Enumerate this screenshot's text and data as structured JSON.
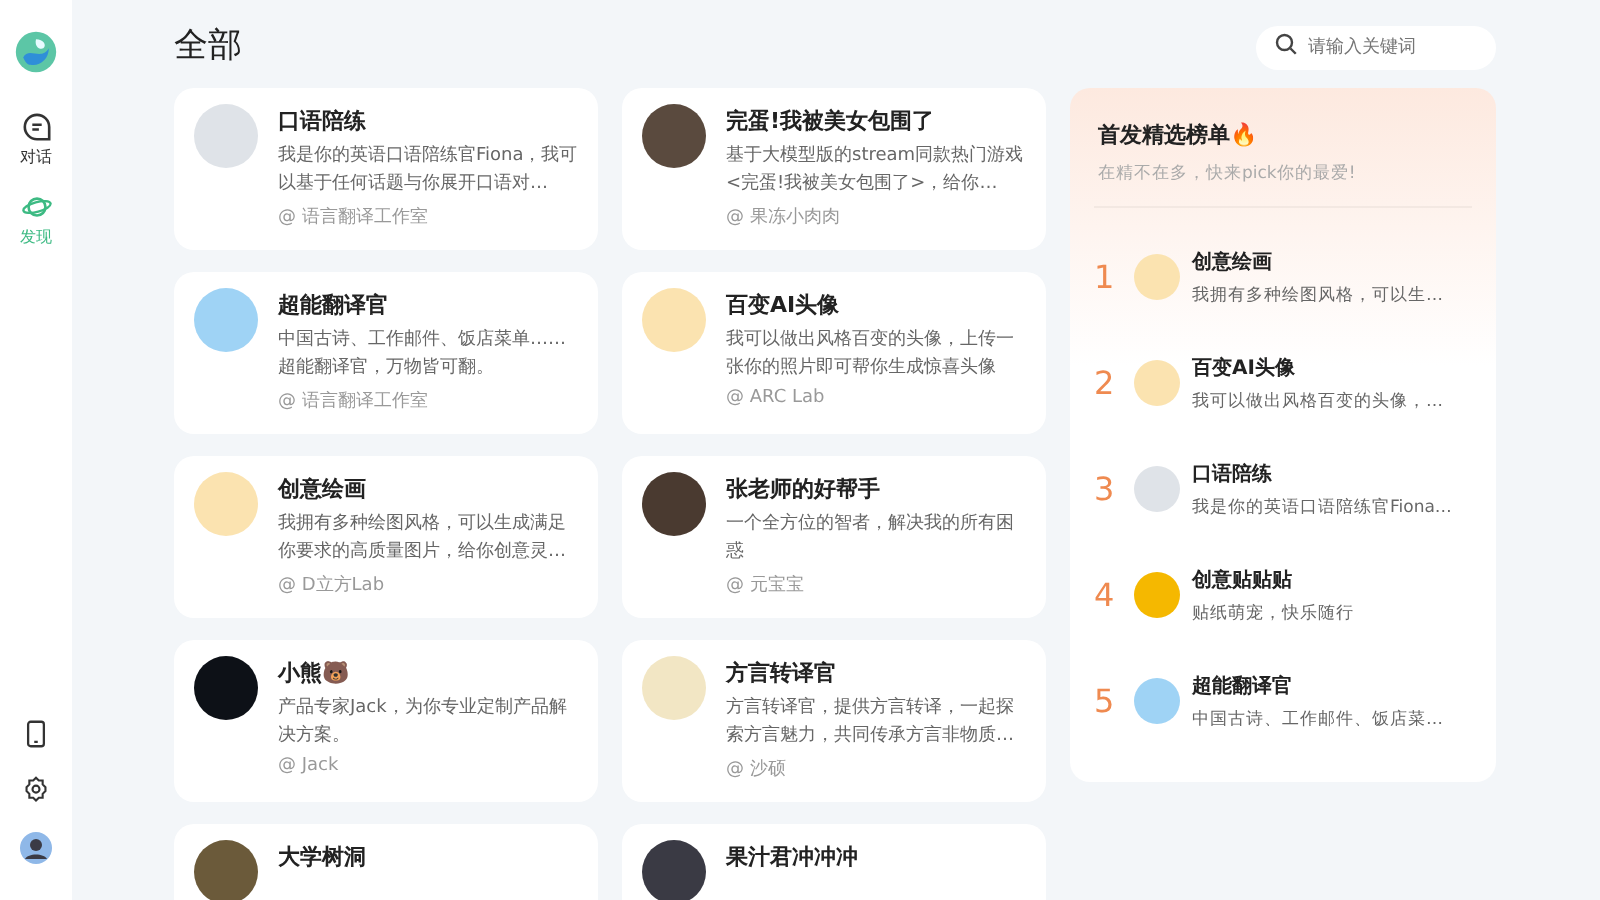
{
  "sidebar": {
    "nav": [
      {
        "label": "对话",
        "kind": "chat",
        "selected": false
      },
      {
        "label": "发现",
        "kind": "discover",
        "selected": true
      }
    ]
  },
  "header": {
    "title": "全部",
    "search": {
      "placeholder": "请输入关键词"
    }
  },
  "cards": [
    {
      "title": "口语陪练",
      "desc": "我是你的英语口语陪练官Fiona，我可以基于任何话题与你展开口语对…",
      "author": "@ 语言翻译工作室",
      "color": "#dfe3e8"
    },
    {
      "title": "完蛋!我被美女包围了",
      "desc": "基于大模型版的stream同款热门游戏<完蛋!我被美女包围了>，给你…",
      "author": "@ 果冻小肉肉",
      "color": "#5a4a3e"
    },
    {
      "title": "超能翻译官",
      "desc": "中国古诗、工作邮件、饭店菜单……超能翻译官，万物皆可翻。",
      "author": "@ 语言翻译工作室",
      "color": "#9fd3f5"
    },
    {
      "title": "百变AI头像",
      "desc": "我可以做出风格百变的头像，上传一张你的照片即可帮你生成惊喜头像",
      "author": "@ ARC Lab",
      "color": "#fbe3b0"
    },
    {
      "title": "创意绘画",
      "desc": "我拥有多种绘图风格，可以生成满足你要求的高质量图片，给你创意灵…",
      "author": "@ D立方Lab",
      "color": "#fbe3b0"
    },
    {
      "title": "张老师的好帮手",
      "desc": "一个全方位的智者，解决我的所有困惑",
      "author": "@ 元宝宝",
      "color": "#4a3a30"
    },
    {
      "title": "小熊🐻",
      "desc": "产品专家Jack，为你专业定制产品解决方案。",
      "author": "@ Jack",
      "color": "#0d1117"
    },
    {
      "title": "方言转译官",
      "desc": "方言转译官，提供方言转译，一起探索方言魅力，共同传承方言非物质…",
      "author": "@ 沙硕",
      "color": "#f2e6c4"
    },
    {
      "title": "大学树洞",
      "color": "#6b5a3a"
    },
    {
      "title": "果汁君冲冲冲",
      "color": "#3a3a44"
    }
  ],
  "ranking": {
    "title": "首发精选榜单🔥",
    "subtitle": "在精不在多，快来pick你的最爱!",
    "items": [
      {
        "rank": "1",
        "title": "创意绘画",
        "desc": "我拥有多种绘图风格，可以生…",
        "color": "#fbe3b0"
      },
      {
        "rank": "2",
        "title": "百变AI头像",
        "desc": "我可以做出风格百变的头像，…",
        "color": "#fbe3b0"
      },
      {
        "rank": "3",
        "title": "口语陪练",
        "desc": "我是你的英语口语陪练官Fiona…",
        "color": "#dfe3e8"
      },
      {
        "rank": "4",
        "title": "创意贴贴贴",
        "desc": "贴纸萌宠，快乐随行",
        "color": "#f5b800"
      },
      {
        "rank": "5",
        "title": "超能翻译官",
        "desc": "中国古诗、工作邮件、饭店菜…",
        "color": "#9fd3f5"
      }
    ]
  }
}
